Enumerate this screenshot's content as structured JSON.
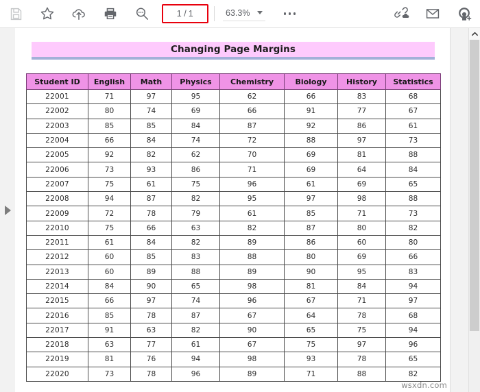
{
  "toolbar": {
    "buttons": [
      {
        "name": "save-button",
        "icon": "floppy-disk-icon",
        "label": "Save",
        "disabled": true
      },
      {
        "name": "favorite-button",
        "icon": "star-icon",
        "label": "Add to favorites",
        "disabled": false
      },
      {
        "name": "upload-button",
        "icon": "cloud-upload-icon",
        "label": "Upload",
        "disabled": false
      },
      {
        "name": "print-button",
        "icon": "printer-icon",
        "label": "Print",
        "disabled": false
      },
      {
        "name": "search-button",
        "icon": "search-icon",
        "label": "Search",
        "disabled": false
      }
    ],
    "page_indicator": {
      "current": "1",
      "separator": "/",
      "total": "1",
      "highlight_color": "#e8000d"
    },
    "zoom": {
      "value": "63.3%",
      "dropdown_icon": "chevron-down-icon"
    },
    "more_options": {
      "icon": "ellipsis-icon",
      "label": "More options"
    },
    "right_buttons": [
      {
        "name": "share-link-button",
        "icon": "link-cloud-icon",
        "label": "Share link"
      },
      {
        "name": "email-button",
        "icon": "envelope-icon",
        "label": "Email"
      },
      {
        "name": "add-person-button",
        "icon": "add-person-icon",
        "label": "Add person"
      }
    ]
  },
  "sidebar": {
    "expand_icon": "triangle-right-icon",
    "expand_label": "Expand sidebar"
  },
  "document": {
    "title": "Changing Page Margins",
    "title_bg": "#fecafd",
    "title_rule_color": "#a3b0d8",
    "header_bg": "#ef93e6",
    "watermark": "wsxdn.com"
  },
  "table": {
    "columns": [
      "Student ID",
      "English",
      "Math",
      "Physics",
      "Chemistry",
      "Biology",
      "History",
      "Statistics"
    ],
    "rows": [
      [
        "22001",
        "71",
        "97",
        "95",
        "62",
        "66",
        "83",
        "68"
      ],
      [
        "22002",
        "80",
        "74",
        "69",
        "66",
        "91",
        "77",
        "67"
      ],
      [
        "22003",
        "85",
        "85",
        "84",
        "87",
        "92",
        "86",
        "61"
      ],
      [
        "22004",
        "66",
        "84",
        "74",
        "72",
        "88",
        "97",
        "73"
      ],
      [
        "22005",
        "92",
        "82",
        "62",
        "70",
        "69",
        "81",
        "88"
      ],
      [
        "22006",
        "73",
        "93",
        "86",
        "71",
        "69",
        "64",
        "84"
      ],
      [
        "22007",
        "75",
        "61",
        "75",
        "96",
        "61",
        "69",
        "65"
      ],
      [
        "22008",
        "94",
        "87",
        "82",
        "95",
        "97",
        "98",
        "88"
      ],
      [
        "22009",
        "72",
        "78",
        "79",
        "61",
        "85",
        "71",
        "73"
      ],
      [
        "22010",
        "75",
        "66",
        "63",
        "82",
        "87",
        "80",
        "82"
      ],
      [
        "22011",
        "61",
        "84",
        "82",
        "89",
        "86",
        "60",
        "80"
      ],
      [
        "22012",
        "60",
        "85",
        "83",
        "88",
        "80",
        "69",
        "66"
      ],
      [
        "22013",
        "60",
        "89",
        "88",
        "89",
        "90",
        "95",
        "83"
      ],
      [
        "22014",
        "84",
        "90",
        "65",
        "98",
        "81",
        "84",
        "94"
      ],
      [
        "22015",
        "66",
        "97",
        "74",
        "96",
        "67",
        "71",
        "97"
      ],
      [
        "22016",
        "85",
        "78",
        "87",
        "67",
        "64",
        "78",
        "68"
      ],
      [
        "22017",
        "91",
        "63",
        "82",
        "90",
        "65",
        "75",
        "94"
      ],
      [
        "22018",
        "63",
        "77",
        "61",
        "67",
        "75",
        "97",
        "96"
      ],
      [
        "22019",
        "81",
        "76",
        "94",
        "98",
        "93",
        "78",
        "65"
      ],
      [
        "22020",
        "73",
        "78",
        "96",
        "89",
        "71",
        "88",
        "82"
      ]
    ]
  },
  "scrollbar": {
    "up_icon": "chevron-up-icon"
  }
}
